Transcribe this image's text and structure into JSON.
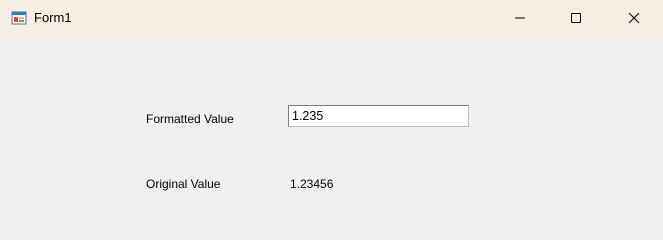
{
  "window": {
    "title": "Form1",
    "icon": "winforms-app-icon",
    "controls": {
      "minimize_icon": "minimize-icon",
      "maximize_icon": "maximize-icon",
      "close_icon": "close-icon"
    }
  },
  "form": {
    "formatted_label": "Formatted Value",
    "formatted_value": "1.235",
    "original_label": "Original Value",
    "original_value": "1.23456"
  }
}
